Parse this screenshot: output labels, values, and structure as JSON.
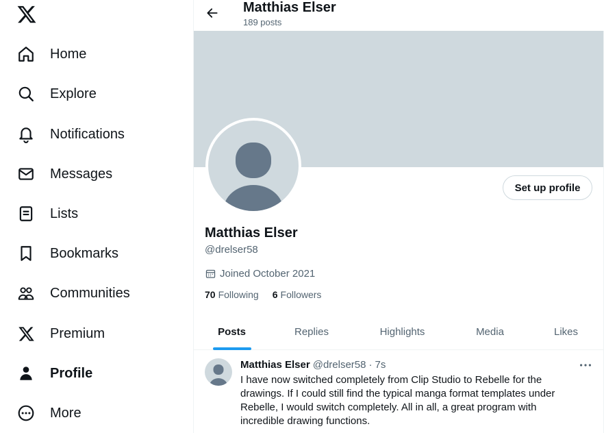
{
  "nav": {
    "logo_icon": "x-logo-icon",
    "items": [
      {
        "label": "Home",
        "icon": "home-icon"
      },
      {
        "label": "Explore",
        "icon": "search-icon"
      },
      {
        "label": "Notifications",
        "icon": "bell-icon"
      },
      {
        "label": "Messages",
        "icon": "envelope-icon"
      },
      {
        "label": "Lists",
        "icon": "list-icon"
      },
      {
        "label": "Bookmarks",
        "icon": "bookmark-icon"
      },
      {
        "label": "Communities",
        "icon": "people-icon"
      },
      {
        "label": "Premium",
        "icon": "x-logo-icon"
      },
      {
        "label": "Profile",
        "icon": "person-icon"
      },
      {
        "label": "More",
        "icon": "more-circle-icon"
      }
    ],
    "active": "Profile"
  },
  "header": {
    "title": "Matthias Elser",
    "subtitle": "189 posts"
  },
  "profile": {
    "setup_button": "Set up profile",
    "name": "Matthias Elser",
    "handle": "@drelser58",
    "joined": "Joined October 2021",
    "following_count": "70",
    "following_label": "Following",
    "followers_count": "6",
    "followers_label": "Followers"
  },
  "tabs": [
    {
      "label": "Posts",
      "active": true
    },
    {
      "label": "Replies",
      "active": false
    },
    {
      "label": "Highlights",
      "active": false
    },
    {
      "label": "Media",
      "active": false
    },
    {
      "label": "Likes",
      "active": false
    }
  ],
  "post": {
    "author": "Matthias Elser",
    "handle": "@drelser58",
    "separator": "·",
    "time": "7s",
    "text": "I have now switched completely from Clip Studio to Rebelle for the drawings. If I could still find the typical manga format templates under Rebelle, I would switch completely. All in all, a great program with incredible drawing functions."
  },
  "colors": {
    "accent": "#1d9bf0",
    "banner": "#cfd9de",
    "secondary_text": "#536471",
    "avatar_silhouette": "#66788a"
  }
}
